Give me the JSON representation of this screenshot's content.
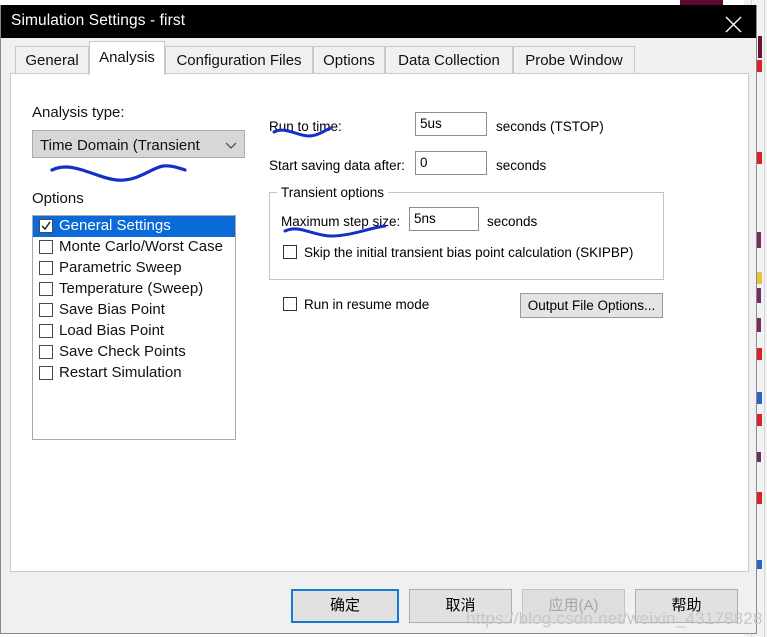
{
  "window": {
    "title": "Simulation Settings - first",
    "close_icon": "close-x-icon"
  },
  "tabs": [
    {
      "label": "General",
      "active": false
    },
    {
      "label": "Analysis",
      "active": true
    },
    {
      "label": "Configuration Files",
      "active": false
    },
    {
      "label": "Options",
      "active": false
    },
    {
      "label": "Data Collection",
      "active": false
    },
    {
      "label": "Probe Window",
      "active": false
    }
  ],
  "left_panel": {
    "analysis_type_label": "Analysis type:",
    "analysis_type_value": "Time Domain (Transient",
    "options_label": "Options",
    "options": [
      {
        "label": "General Settings",
        "checked": true,
        "selected": true
      },
      {
        "label": "Monte Carlo/Worst Case",
        "checked": false,
        "selected": false
      },
      {
        "label": "Parametric Sweep",
        "checked": false,
        "selected": false
      },
      {
        "label": "Temperature (Sweep)",
        "checked": false,
        "selected": false
      },
      {
        "label": "Save Bias Point",
        "checked": false,
        "selected": false
      },
      {
        "label": "Load Bias Point",
        "checked": false,
        "selected": false
      },
      {
        "label": "Save Check Points",
        "checked": false,
        "selected": false
      },
      {
        "label": "Restart Simulation",
        "checked": false,
        "selected": false
      }
    ]
  },
  "right_panel": {
    "run_to_time_label": "Run to time:",
    "run_to_time_value": "5us",
    "run_to_time_units": "seconds  (TSTOP)",
    "start_saving_label": "Start saving data after:",
    "start_saving_value": "0",
    "start_saving_units": "seconds",
    "transient_group_title": "Transient options",
    "max_step_label": "Maximum step size:",
    "max_step_value": "5ns",
    "max_step_units": "seconds",
    "skipbp_label": "Skip the initial transient bias point calculation  (SKIPBP)",
    "skipbp_checked": false,
    "resume_label": "Run in resume mode",
    "resume_checked": false,
    "output_file_options_label": "Output File Options..."
  },
  "footer": {
    "ok_label": "确定",
    "cancel_label": "取消",
    "apply_label": "应用(A)",
    "apply_disabled": true,
    "help_label": "帮助"
  },
  "watermark": "https://blog.csdn.net/weixin_43178828",
  "colors": {
    "titlebar": "#000000",
    "selection": "#0a6bd8",
    "default_button_focus": "#1878d4",
    "annotation_ink": "#1430c8",
    "page_background": "#ffffff",
    "dialog_background": "#f0f0f0"
  }
}
